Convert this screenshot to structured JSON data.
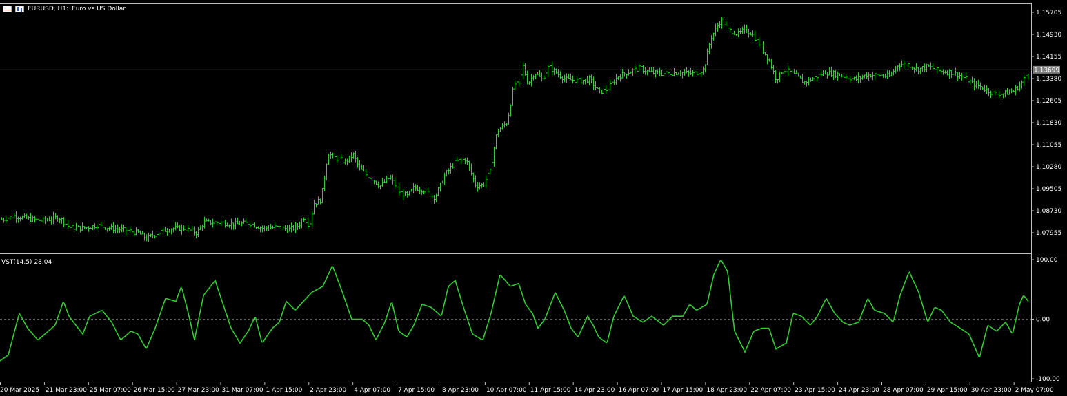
{
  "header": {
    "symbol_label": "EURUSD, H1:",
    "description": "Euro vs US Dollar"
  },
  "indicator": {
    "name": "VST(14,5)",
    "value": "28.04"
  },
  "price_axis": {
    "ticks": [
      "1.15705",
      "1.14930",
      "1.14155",
      "1.13380",
      "1.12605",
      "1.11830",
      "1.11055",
      "1.10280",
      "1.09505",
      "1.08730",
      "1.07955"
    ],
    "current_price": "1.13699"
  },
  "indicator_axis": {
    "ticks": [
      "100.00",
      "0.00",
      "-100.00"
    ]
  },
  "time_axis": {
    "labels": [
      "20 Mar 2025",
      "21 Mar 23:00",
      "25 Mar 07:00",
      "26 Mar 15:00",
      "27 Mar 23:00",
      "31 Mar 07:00",
      "1 Apr 15:00",
      "2 Apr 23:00",
      "4 Apr 07:00",
      "7 Apr 15:00",
      "8 Apr 23:00",
      "10 Apr 07:00",
      "11 Apr 15:00",
      "14 Apr 23:00",
      "16 Apr 07:00",
      "17 Apr 15:00",
      "18 Apr 23:00",
      "22 Apr 07:00",
      "23 Apr 15:00",
      "24 Apr 23:00",
      "28 Apr 07:00",
      "29 Apr 15:00",
      "30 Apr 23:00",
      "2 May 07:00"
    ]
  },
  "colors": {
    "background": "#000000",
    "bars": "#32cd32",
    "indicator_line": "#32cd32",
    "axis_text": "#ffffff",
    "price_line": "#808080",
    "price_label_bg": "#808080"
  },
  "chart_data": {
    "type": "line",
    "title": "EURUSD, H1: Euro vs US Dollar",
    "price_range": [
      1.0745,
      1.1595
    ],
    "price_path": [
      [
        0,
        1.084
      ],
      [
        20,
        1.0855
      ],
      [
        40,
        1.0845
      ],
      [
        60,
        1.0838
      ],
      [
        85,
        1.085
      ],
      [
        100,
        1.0815
      ],
      [
        120,
        1.0812
      ],
      [
        140,
        1.0822
      ],
      [
        160,
        1.0812
      ],
      [
        180,
        1.0805
      ],
      [
        200,
        1.0795
      ],
      [
        212,
        1.0775
      ],
      [
        225,
        1.0792
      ],
      [
        245,
        1.081
      ],
      [
        265,
        1.0812
      ],
      [
        285,
        1.0795
      ],
      [
        295,
        1.0832
      ],
      [
        320,
        1.0832
      ],
      [
        340,
        1.0825
      ],
      [
        360,
        1.083
      ],
      [
        380,
        1.0812
      ],
      [
        400,
        1.0815
      ],
      [
        420,
        1.0808
      ],
      [
        432,
        1.082
      ],
      [
        440,
        1.085
      ],
      [
        448,
        1.082
      ],
      [
        455,
        1.09
      ],
      [
        465,
        1.091
      ],
      [
        475,
        1.1075
      ],
      [
        485,
        1.106
      ],
      [
        500,
        1.1045
      ],
      [
        512,
        1.107
      ],
      [
        520,
        1.1025
      ],
      [
        530,
        1.1
      ],
      [
        540,
        1.0985
      ],
      [
        550,
        1.096
      ],
      [
        565,
        1.099
      ],
      [
        578,
        1.094
      ],
      [
        590,
        1.0925
      ],
      [
        600,
        1.0955
      ],
      [
        615,
        1.0945
      ],
      [
        630,
        1.092
      ],
      [
        645,
        1.1
      ],
      [
        660,
        1.1045
      ],
      [
        675,
        1.1055
      ],
      [
        690,
        1.096
      ],
      [
        700,
        1.0965
      ],
      [
        710,
        1.101
      ],
      [
        720,
        1.115
      ],
      [
        735,
        1.1185
      ],
      [
        745,
        1.132
      ],
      [
        752,
        1.1315
      ],
      [
        758,
        1.138
      ],
      [
        765,
        1.132
      ],
      [
        775,
        1.136
      ],
      [
        785,
        1.1335
      ],
      [
        795,
        1.138
      ],
      [
        805,
        1.136
      ],
      [
        820,
        1.1335
      ],
      [
        840,
        1.133
      ],
      [
        855,
        1.1335
      ],
      [
        868,
        1.129
      ],
      [
        880,
        1.13
      ],
      [
        895,
        1.1345
      ],
      [
        910,
        1.136
      ],
      [
        928,
        1.1375
      ],
      [
        940,
        1.136
      ],
      [
        960,
        1.1355
      ],
      [
        985,
        1.136
      ],
      [
        1005,
        1.1355
      ],
      [
        1020,
        1.137
      ],
      [
        1030,
        1.148
      ],
      [
        1045,
        1.1545
      ],
      [
        1055,
        1.151
      ],
      [
        1070,
        1.1495
      ],
      [
        1080,
        1.151
      ],
      [
        1090,
        1.1495
      ],
      [
        1100,
        1.146
      ],
      [
        1115,
        1.14
      ],
      [
        1125,
        1.1335
      ],
      [
        1135,
        1.137
      ],
      [
        1145,
        1.136
      ],
      [
        1155,
        1.1345
      ],
      [
        1165,
        1.1325
      ],
      [
        1180,
        1.134
      ],
      [
        1195,
        1.136
      ],
      [
        1210,
        1.1355
      ],
      [
        1225,
        1.1345
      ],
      [
        1240,
        1.1335
      ],
      [
        1255,
        1.135
      ],
      [
        1275,
        1.135
      ],
      [
        1290,
        1.1345
      ],
      [
        1300,
        1.1385
      ],
      [
        1315,
        1.139
      ],
      [
        1330,
        1.137
      ],
      [
        1345,
        1.138
      ],
      [
        1360,
        1.1365
      ],
      [
        1380,
        1.136
      ],
      [
        1395,
        1.1345
      ],
      [
        1410,
        1.132
      ],
      [
        1425,
        1.1305
      ],
      [
        1440,
        1.1285
      ],
      [
        1455,
        1.1285
      ],
      [
        1470,
        1.1295
      ],
      [
        1480,
        1.132
      ],
      [
        1490,
        1.136
      ]
    ],
    "indicator_range": [
      -100,
      100
    ],
    "indicator_path": [
      [
        0,
        -70
      ],
      [
        12,
        -60
      ],
      [
        28,
        10
      ],
      [
        40,
        -15
      ],
      [
        55,
        -35
      ],
      [
        70,
        -20
      ],
      [
        80,
        -10
      ],
      [
        92,
        30
      ],
      [
        100,
        5
      ],
      [
        110,
        -10
      ],
      [
        120,
        -25
      ],
      [
        130,
        5
      ],
      [
        148,
        15
      ],
      [
        162,
        -5
      ],
      [
        175,
        -35
      ],
      [
        190,
        -20
      ],
      [
        200,
        -25
      ],
      [
        212,
        -50
      ],
      [
        225,
        -15
      ],
      [
        240,
        35
      ],
      [
        255,
        30
      ],
      [
        263,
        55
      ],
      [
        272,
        15
      ],
      [
        282,
        -35
      ],
      [
        295,
        40
      ],
      [
        312,
        65
      ],
      [
        322,
        30
      ],
      [
        335,
        -15
      ],
      [
        348,
        -40
      ],
      [
        360,
        -20
      ],
      [
        370,
        5
      ],
      [
        380,
        -40
      ],
      [
        395,
        -15
      ],
      [
        405,
        -5
      ],
      [
        415,
        30
      ],
      [
        428,
        15
      ],
      [
        440,
        30
      ],
      [
        452,
        45
      ],
      [
        468,
        55
      ],
      [
        482,
        90
      ],
      [
        495,
        50
      ],
      [
        510,
        0
      ],
      [
        525,
        0
      ],
      [
        535,
        -10
      ],
      [
        545,
        -35
      ],
      [
        558,
        -5
      ],
      [
        568,
        30
      ],
      [
        578,
        -20
      ],
      [
        590,
        -30
      ],
      [
        600,
        -10
      ],
      [
        612,
        25
      ],
      [
        625,
        20
      ],
      [
        640,
        5
      ],
      [
        650,
        55
      ],
      [
        660,
        65
      ],
      [
        672,
        20
      ],
      [
        685,
        -25
      ],
      [
        700,
        -35
      ],
      [
        712,
        10
      ],
      [
        725,
        75
      ],
      [
        740,
        55
      ],
      [
        752,
        60
      ],
      [
        762,
        25
      ],
      [
        772,
        10
      ],
      [
        780,
        -15
      ],
      [
        790,
        0
      ],
      [
        805,
        45
      ],
      [
        818,
        15
      ],
      [
        828,
        -15
      ],
      [
        838,
        -30
      ],
      [
        852,
        5
      ],
      [
        860,
        -10
      ],
      [
        868,
        -30
      ],
      [
        880,
        -40
      ],
      [
        890,
        5
      ],
      [
        905,
        40
      ],
      [
        918,
        5
      ],
      [
        932,
        -5
      ],
      [
        945,
        5
      ],
      [
        962,
        -10
      ],
      [
        975,
        5
      ],
      [
        990,
        5
      ],
      [
        1000,
        25
      ],
      [
        1010,
        15
      ],
      [
        1025,
        25
      ],
      [
        1035,
        75
      ],
      [
        1045,
        100
      ],
      [
        1055,
        80
      ],
      [
        1065,
        -20
      ],
      [
        1080,
        -55
      ],
      [
        1093,
        -20
      ],
      [
        1105,
        -15
      ],
      [
        1115,
        -15
      ],
      [
        1125,
        -50
      ],
      [
        1140,
        -40
      ],
      [
        1150,
        10
      ],
      [
        1162,
        5
      ],
      [
        1175,
        -10
      ],
      [
        1185,
        5
      ],
      [
        1198,
        35
      ],
      [
        1210,
        10
      ],
      [
        1222,
        -5
      ],
      [
        1232,
        -10
      ],
      [
        1245,
        -5
      ],
      [
        1258,
        35
      ],
      [
        1268,
        15
      ],
      [
        1282,
        10
      ],
      [
        1295,
        -5
      ],
      [
        1305,
        40
      ],
      [
        1318,
        80
      ],
      [
        1332,
        45
      ],
      [
        1345,
        -5
      ],
      [
        1355,
        20
      ],
      [
        1365,
        15
      ],
      [
        1378,
        -5
      ],
      [
        1392,
        -15
      ],
      [
        1405,
        -25
      ],
      [
        1420,
        -65
      ],
      [
        1432,
        -10
      ],
      [
        1445,
        -20
      ],
      [
        1458,
        -5
      ],
      [
        1468,
        -25
      ],
      [
        1478,
        25
      ],
      [
        1484,
        40
      ],
      [
        1491,
        30
      ]
    ]
  }
}
